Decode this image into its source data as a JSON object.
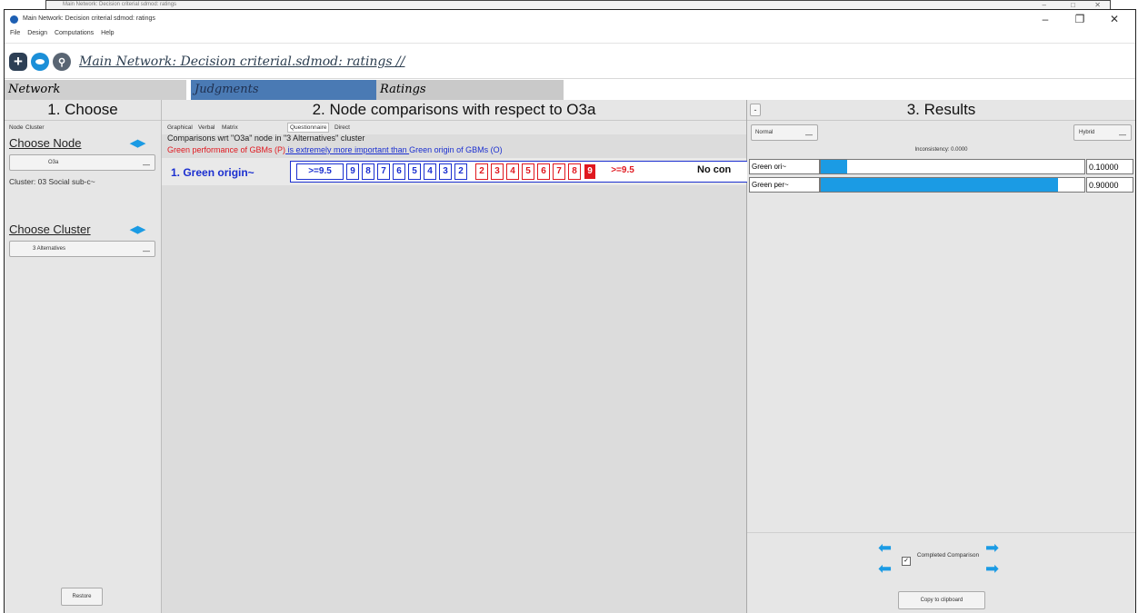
{
  "background_window": {
    "title": "Main Network: Decision criterial sdmod: ratings"
  },
  "window": {
    "title": "Main Network: Decision criterial sdmod: ratings",
    "minimize": "–",
    "maximize": "❐",
    "close": "✕"
  },
  "menu": {
    "items": [
      "File",
      "Design",
      "Computations",
      "Help"
    ]
  },
  "toolbar": {
    "path": "Main Network: Decision criterial.sdmod: ratings //"
  },
  "top_tabs": [
    {
      "label": "Network"
    },
    {
      "label": "Judgments"
    },
    {
      "label": "Ratings"
    }
  ],
  "choose": {
    "header": "1. Choose",
    "subtabs": [
      "Node",
      "Cluster"
    ],
    "choose_node_label": "Choose Node",
    "node_value": "O3a",
    "cluster_info": "Cluster: 03 Social sub-c~",
    "choose_cluster_label": "Choose Cluster",
    "cluster_value": "3 Alternatives",
    "restore_button": "Restore"
  },
  "comparisons": {
    "header": "2. Node comparisons with respect to O3a",
    "subtabs": [
      "Graphical",
      "Verbal",
      "Matrix",
      "Questionnaire",
      "Direct"
    ],
    "desc_line": "Comparisons wrt \"O3a\" node in \"3 Alternatives\" cluster",
    "verbal_left": "Green performance of GBMs (P)",
    "verbal_mid": " is extremely more important than ",
    "verbal_right": "Green origin of GBMs (O)",
    "row_label": "1. Green origin~",
    "left_scale": [
      ">=9.5",
      "9",
      "8",
      "7",
      "6",
      "5",
      "4",
      "3",
      "2"
    ],
    "right_scale": [
      "2",
      "3",
      "4",
      "5",
      "6",
      "7",
      "8",
      "9",
      ">=9.5"
    ],
    "selected_value": "9",
    "trailing": "No con"
  },
  "results": {
    "header": "3. Results",
    "toggle_button": "-",
    "mode_left": "Normal",
    "mode_right": "Hybrid",
    "inconsistency": "Inconsistency: 0.0000",
    "rows": [
      {
        "label": "Green ori~",
        "value": "0.10000",
        "fraction": 0.1
      },
      {
        "label": "Green per~",
        "value": "0.90000",
        "fraction": 0.9
      }
    ],
    "completed_label": "Completed Comparison",
    "copy_button": "Copy to clipboard"
  },
  "colors": {
    "accent_blue": "#1b9be4",
    "selected_tab": "#4a7ab4",
    "red": "#e0181f",
    "blue_text": "#1b2fd0"
  }
}
